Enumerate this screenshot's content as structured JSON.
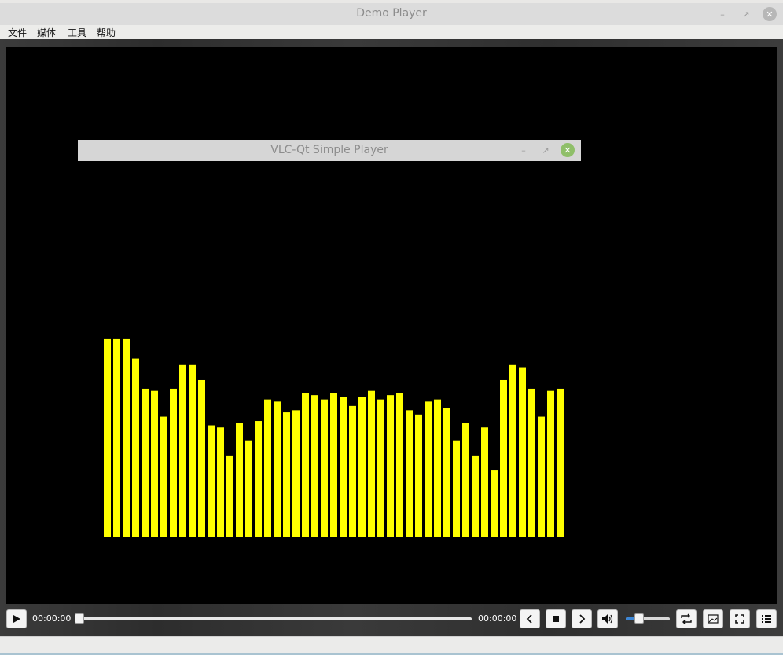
{
  "window": {
    "title": "Demo Player"
  },
  "menu": {
    "items": [
      "文件",
      "媒体",
      "工具",
      "帮助"
    ]
  },
  "player": {
    "title": "VLC-Qt Simple Player",
    "time_current": "00:00:00",
    "time_total": "00:00:00",
    "seek_fraction": 0.0,
    "volume_fraction": 0.3
  },
  "icons": [
    "play-icon",
    "prev-icon",
    "stop-icon",
    "next-icon",
    "volume-icon",
    "repeat-icon",
    "snapshot-icon",
    "fullscreen-icon",
    "playlist-icon"
  ],
  "colors": {
    "bar": "#ffff00",
    "video_bg": "#000000",
    "accent": "#3b86d6"
  },
  "chart_data": {
    "type": "bar",
    "title": "",
    "values": [
      92,
      92,
      92,
      83,
      69,
      68,
      56,
      69,
      80,
      80,
      73,
      52,
      51,
      38,
      53,
      45,
      54,
      64,
      63,
      58,
      59,
      67,
      66,
      64,
      67,
      65,
      61,
      65,
      68,
      64,
      66,
      67,
      59,
      57,
      63,
      64,
      60,
      45,
      53,
      38,
      51,
      31,
      73,
      80,
      79,
      69,
      56,
      68,
      69
    ],
    "ylim": [
      0,
      100
    ]
  }
}
